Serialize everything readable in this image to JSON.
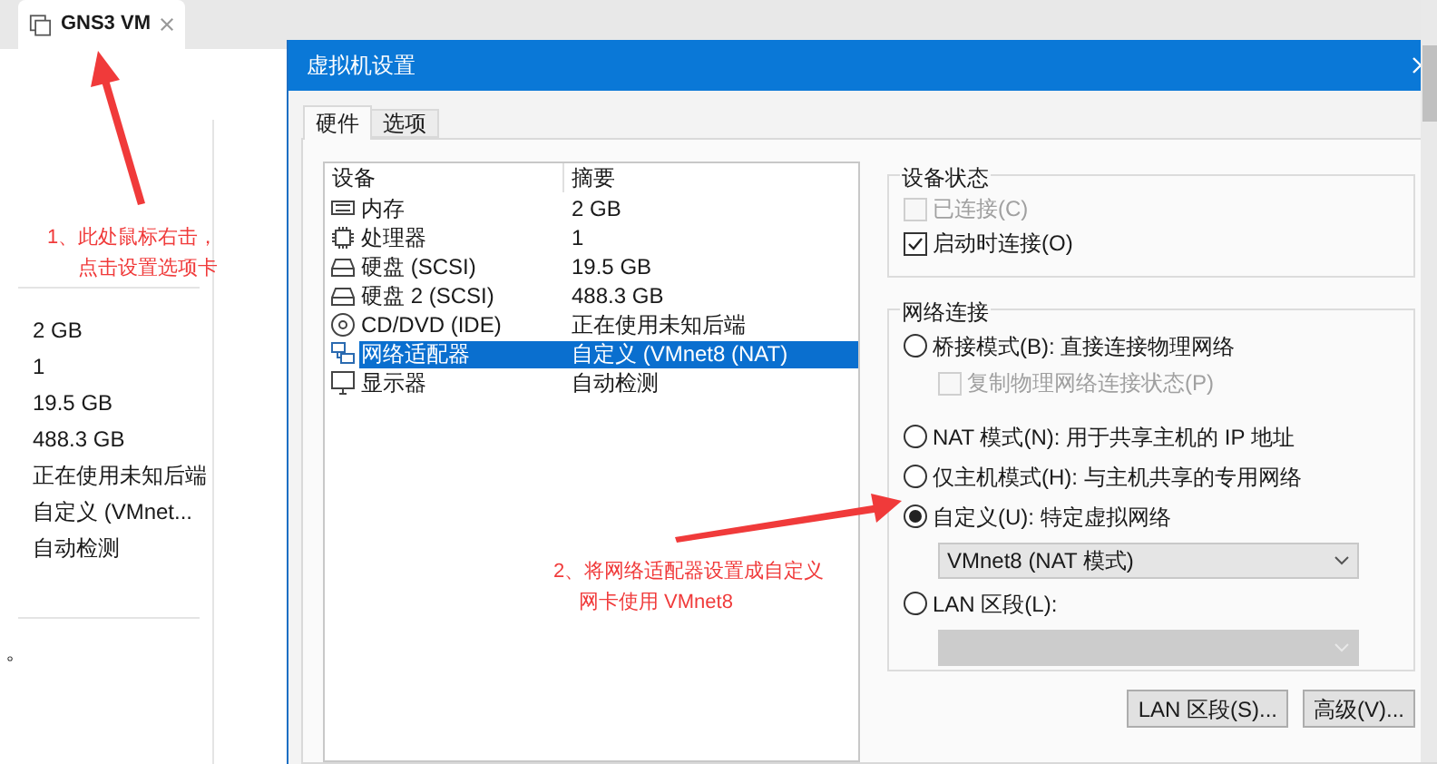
{
  "app_tab": {
    "title": "GNS3 VM",
    "selected": true
  },
  "summary_values": [
    "2 GB",
    "1",
    "19.5 GB",
    "488.3 GB",
    "正在使用未知后端",
    "自定义 (VMnet...",
    "自动检测"
  ],
  "stray_mark": "。",
  "dialog": {
    "title": "虚拟机设置",
    "tabs": [
      {
        "label": "硬件",
        "selected": true
      },
      {
        "label": "选项",
        "selected": false
      }
    ],
    "devices": {
      "columns": [
        "设备",
        "摘要"
      ],
      "rows": [
        {
          "kind": "memory",
          "device": "内存",
          "summary": "2 GB",
          "selected": false
        },
        {
          "kind": "cpu",
          "device": "处理器",
          "summary": "1",
          "selected": false
        },
        {
          "kind": "disk",
          "device": "硬盘 (SCSI)",
          "summary": "19.5 GB",
          "selected": false
        },
        {
          "kind": "disk",
          "device": "硬盘 2 (SCSI)",
          "summary": "488.3 GB",
          "selected": false
        },
        {
          "kind": "cd",
          "device": "CD/DVD (IDE)",
          "summary": "正在使用未知后端",
          "selected": false
        },
        {
          "kind": "network",
          "device": "网络适配器",
          "summary": "自定义 (VMnet8 (NAT)",
          "selected": true
        },
        {
          "kind": "display",
          "device": "显示器",
          "summary": "自动检测",
          "selected": false
        }
      ]
    },
    "device_status": {
      "title": "设备状态",
      "options": [
        {
          "label": "已连接(C)",
          "checked": false,
          "disabled": true
        },
        {
          "label": "启动时连接(O)",
          "checked": true,
          "disabled": false
        }
      ]
    },
    "network": {
      "title": "网络连接",
      "options": [
        {
          "label": "桥接模式(B): 直接连接物理网络",
          "selected": false,
          "sub_checkbox": {
            "label": "复制物理网络连接状态(P)",
            "checked": false,
            "disabled": true
          }
        },
        {
          "label": "NAT 模式(N): 用于共享主机的 IP 地址",
          "selected": false
        },
        {
          "label": "仅主机模式(H): 与主机共享的专用网络",
          "selected": false
        },
        {
          "label": "自定义(U): 特定虚拟网络",
          "selected": true,
          "dropdown": {
            "value": "VMnet8 (NAT 模式)",
            "disabled": false
          }
        },
        {
          "label": "LAN 区段(L):",
          "selected": false,
          "dropdown": {
            "disabled": true
          }
        }
      ]
    },
    "buttons": [
      "LAN 区段(S)...",
      "高级(V)..."
    ]
  },
  "annotations": [
    {
      "lines": [
        "1、此处鼠标右击，",
        "点击设置选项卡"
      ]
    },
    {
      "lines": [
        "2、将网络适配器设置成自定义",
        "网卡使用 VMnet8"
      ]
    }
  ]
}
